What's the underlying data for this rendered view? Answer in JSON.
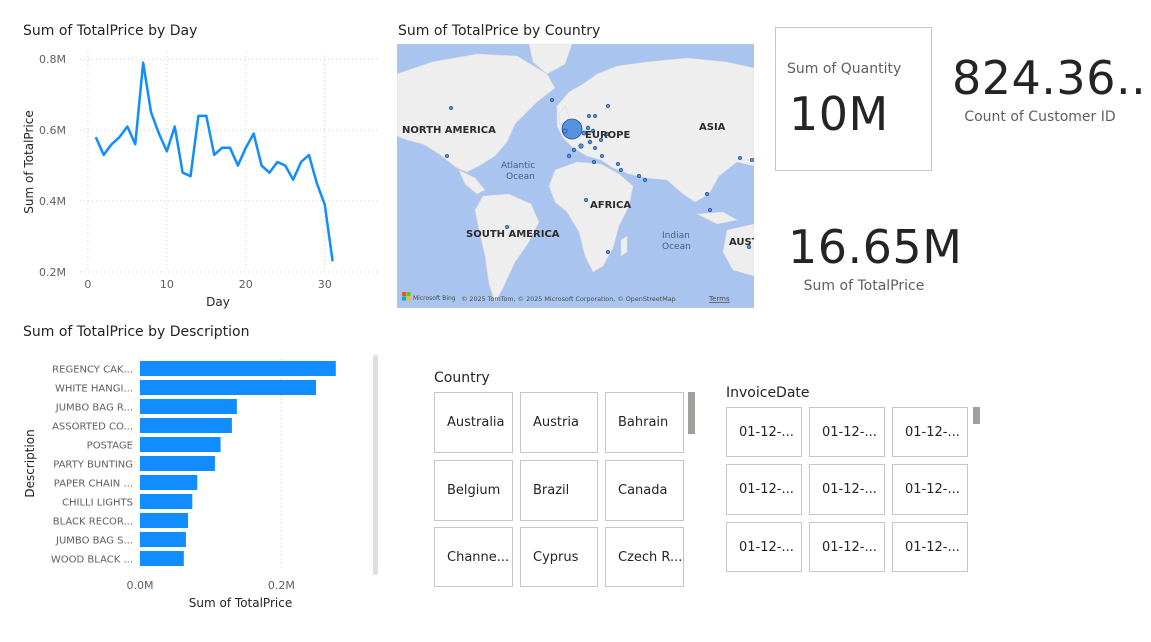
{
  "line_visual": {
    "title": "Sum of TotalPrice by Day"
  },
  "map_visual": {
    "title": "Sum of TotalPrice by Country",
    "continent_labels": [
      "NORTH AMERICA",
      "EUROPE",
      "ASIA",
      "AFRICA",
      "SOUTH AMERICA",
      "AUST"
    ],
    "ocean_labels": [
      "Atlantic",
      "Ocean",
      "Indian",
      "Ocean"
    ],
    "attribution": "© 2025 TomTom, © 2025 Microsoft Corporation, © OpenStreetMap",
    "terms": "Terms",
    "bing_logo": "Microsoft Bing"
  },
  "bar_visual": {
    "title": "Sum of TotalPrice by Description"
  },
  "chart_data": [
    {
      "type": "line",
      "title": "Sum of TotalPrice by Day",
      "xlabel": "Day",
      "ylabel": "Sum of TotalPrice",
      "x": [
        1,
        2,
        3,
        4,
        5,
        6,
        7,
        8,
        9,
        10,
        11,
        12,
        13,
        14,
        15,
        16,
        17,
        18,
        19,
        20,
        21,
        22,
        23,
        24,
        25,
        26,
        27,
        28,
        29,
        30,
        31
      ],
      "values": [
        0.58,
        0.53,
        0.56,
        0.58,
        0.61,
        0.56,
        0.79,
        0.65,
        0.59,
        0.54,
        0.61,
        0.48,
        0.47,
        0.64,
        0.64,
        0.53,
        0.55,
        0.55,
        0.5,
        0.55,
        0.59,
        0.5,
        0.48,
        0.51,
        0.5,
        0.46,
        0.51,
        0.53,
        0.45,
        0.39,
        0.23
      ],
      "xticks": [
        0,
        10,
        20,
        30
      ],
      "xtick_labels": [
        "0",
        "10",
        "20",
        "30"
      ],
      "yticks": [
        0.2,
        0.4,
        0.6,
        0.8
      ],
      "ytick_labels": [
        "0.2M",
        "0.4M",
        "0.6M",
        "0.8M"
      ],
      "xlim": [
        -1,
        37
      ],
      "ylim": [
        0.2,
        0.82
      ],
      "color": "#118DFF"
    },
    {
      "type": "bar",
      "orientation": "horizontal",
      "title": "Sum of TotalPrice by Description",
      "xlabel": "Sum of TotalPrice",
      "ylabel": "Description",
      "categories": [
        "REGENCY CAK...",
        "WHITE HANGI...",
        "JUMBO BAG R...",
        "ASSORTED CO...",
        "POSTAGE",
        "PARTY BUNTING",
        "PAPER CHAIN ...",
        "CHILLI LIGHTS",
        "BLACK RECOR...",
        "JUMBO BAG S...",
        "WOOD BLACK ..."
      ],
      "values": [
        0.277,
        0.249,
        0.137,
        0.13,
        0.114,
        0.106,
        0.081,
        0.074,
        0.068,
        0.065,
        0.062
      ],
      "xticks": [
        0,
        0.2
      ],
      "xtick_labels": [
        "0.0M",
        "0.2M"
      ],
      "xlim": [
        0,
        0.29
      ],
      "color": "#118DFF"
    }
  ],
  "card_quantity": {
    "label": "Sum of Quantity",
    "value": "10M"
  },
  "kpi_customers": {
    "value": "824.36...",
    "label": "Count of Customer ID"
  },
  "kpi_total": {
    "value": "16.65M",
    "label": "Sum of TotalPrice"
  },
  "country_slicer": {
    "title": "Country",
    "items": [
      "Australia",
      "Austria",
      "Bahrain",
      "Belgium",
      "Brazil",
      "Canada",
      "Channe...",
      "Cyprus",
      "Czech R..."
    ]
  },
  "date_slicer": {
    "title": "InvoiceDate",
    "items": [
      "01-12-...",
      "01-12-...",
      "01-12-...",
      "01-12-...",
      "01-12-...",
      "01-12-...",
      "01-12-...",
      "01-12-...",
      "01-12-..."
    ]
  }
}
